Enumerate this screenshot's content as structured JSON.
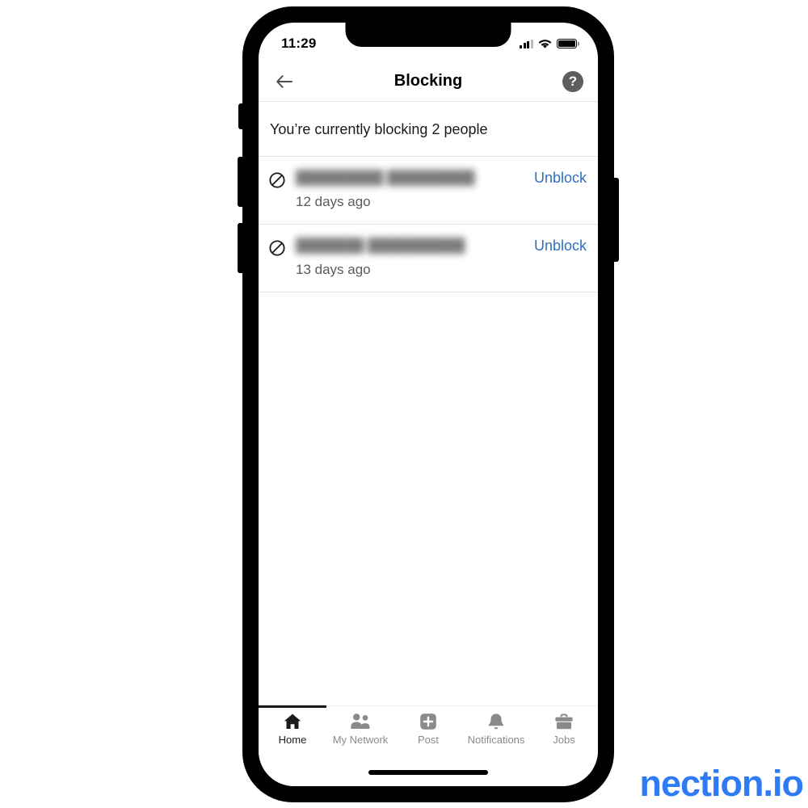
{
  "colors": {
    "accent_link": "#2f6fc0",
    "watermark": "#2f7bf6",
    "tab_active": "#1a1a1a",
    "tab_inactive": "#8a8a8a",
    "help_badge": "#5e5e5e"
  },
  "status_bar": {
    "time": "11:29",
    "signal_icon": "cellular-signal-icon",
    "wifi_icon": "wifi-icon",
    "battery_icon": "battery-icon"
  },
  "header": {
    "back_icon": "back-arrow-icon",
    "title": "Blocking",
    "help_label": "?"
  },
  "content": {
    "summary": "You’re currently blocking 2 people",
    "blocked": [
      {
        "name": "█████████ █████████",
        "when": "12 days ago",
        "action": "Unblock",
        "icon": "block-slash-icon"
      },
      {
        "name": "███████ ██████████",
        "when": "13 days ago",
        "action": "Unblock",
        "icon": "block-slash-icon"
      }
    ]
  },
  "tab_bar": {
    "active_index": 0,
    "tabs": [
      {
        "label": "Home",
        "icon": "home-icon"
      },
      {
        "label": "My Network",
        "icon": "people-icon"
      },
      {
        "label": "Post",
        "icon": "plus-square-icon"
      },
      {
        "label": "Notifications",
        "icon": "bell-icon"
      },
      {
        "label": "Jobs",
        "icon": "briefcase-icon"
      }
    ]
  },
  "watermark": {
    "text": "nection.io"
  }
}
